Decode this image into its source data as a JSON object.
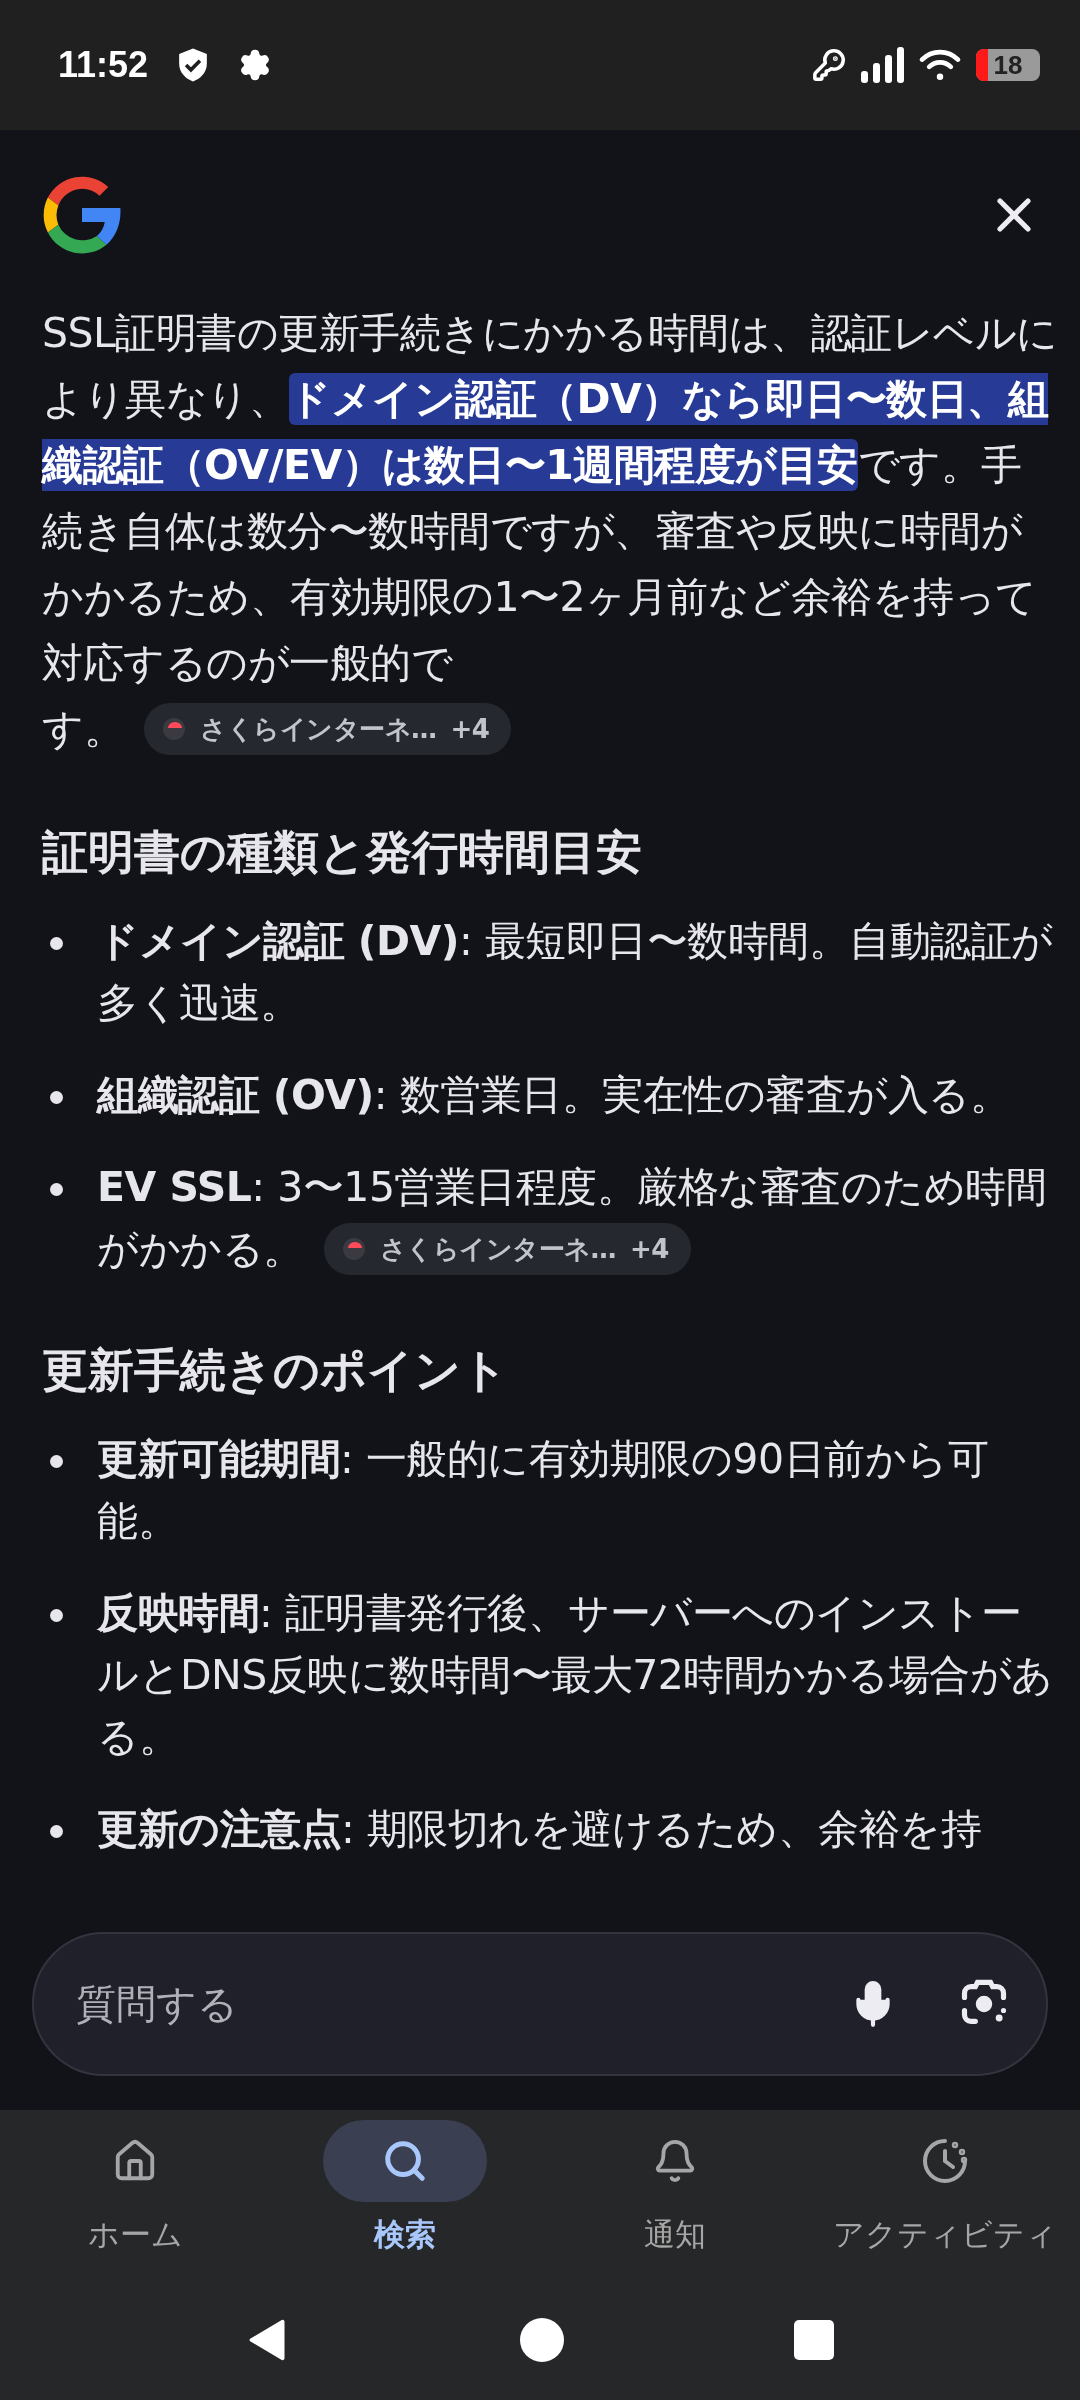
{
  "status_bar": {
    "time": "11:52",
    "battery": "18"
  },
  "answer": {
    "text": "SSL証明書の更新手続きにかかる時間は、認証レベルにより異なり、**ドメイン認証（DV）なら即日〜数日、組織認証（OV/EV）は数日〜1週間程度が目安**です。手続き自体は数分〜数時間ですが、審査や反映に時間がかかるため、有効期限の1〜2ヶ月前など余裕を持って対応するのが一般的で",
    "tail": "す。",
    "source": {
      "label": "さくらインターネ…",
      "more": "+4"
    }
  },
  "sections": [
    {
      "heading": "証明書の種類と発行時間目安",
      "items": [
        {
          "text": "**ドメイン認証 (DV)**: 最短即日〜数時間。自動認証が多く迅速。"
        },
        {
          "text": "**組織認証 (OV)**: 数営業日。実在性の審査が入る。"
        },
        {
          "text": "**EV SSL**: 3〜15営業日程度。厳格な審査のため時間",
          "tail": "がかかる。",
          "source": {
            "label": "さくらインターネ…",
            "more": "+4"
          }
        }
      ]
    },
    {
      "heading": "更新手続きのポイント",
      "items": [
        {
          "text": "**更新可能期間**: 一般的に有効期限の90日前から可能。"
        },
        {
          "text": "**反映時間**: 証明書発行後、サーバーへのインストールとDNS反映に数時間〜最大72時間かかる場合がある。"
        },
        {
          "text": "**更新の注意点**: 期限切れを避けるため、余裕を持"
        }
      ]
    }
  ],
  "search_box": {
    "placeholder": "質問する"
  },
  "nav": [
    {
      "label": "ホーム",
      "selected": false,
      "kind": "home"
    },
    {
      "label": "検索",
      "selected": true,
      "kind": "search"
    },
    {
      "label": "通知",
      "selected": false,
      "kind": "bell"
    },
    {
      "label": "アクティビティ",
      "selected": false,
      "kind": "activity"
    }
  ]
}
